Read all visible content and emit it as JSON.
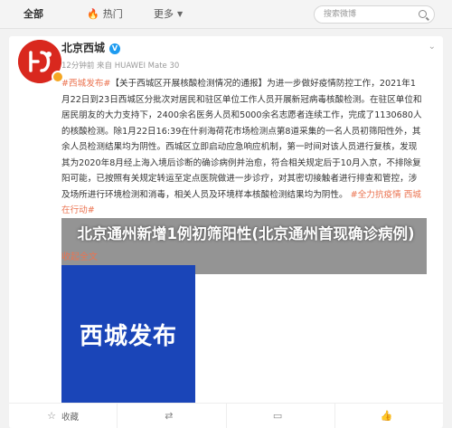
{
  "topbar": {
    "tabs": [
      {
        "label": "全部"
      },
      {
        "label": "热门"
      },
      {
        "label": "更多"
      }
    ],
    "search_placeholder": "搜索微博"
  },
  "post": {
    "author": "北京西城",
    "verified_mark": "V",
    "meta": "12分钟前 来自 HUAWEI Mate 30",
    "hashtag": "#西城发布#",
    "bracket_title": "【关于西城区开展核酸检测情况的通报】",
    "body_1": "为进一步做好疫情防控工作，2021年1月22日到23日西城区分批次对居民和驻区单位工作人员开展新冠病毒核酸检测。在驻区单位和居民朋友的大力支持下，2400余名医务人员和5000余名志愿者连续工作，完成了1130680人的核酸检测。除1月22日16:39在什刹海荷花市场检测点第8道采集的一名人员初筛阳性外，其余人员检测结果均为阴性。西城区立即启动应急响应机制，第一时间对该人员进行复核，发现其为2020年8月经上海入境后诊断的确诊病例并治愈，符合相关规定后于10月入京，不排除复阳可能，已按照有关规定转运至定点医院做进一步诊疗，对其密切接触者进行排查和管控，涉及场所进行环境检测和消毒，相关人员及环境样本核酸检测结果均为阴性。",
    "hashtag_2": "#全力抗疫情 西城在行动#",
    "collapse": "收起全文",
    "image_text": "西城发布",
    "overlay_title": "北京通州新增1例初筛阳性(北京通州首现确诊病例)"
  },
  "actions": [
    {
      "label": "收藏"
    },
    {
      "label": ""
    },
    {
      "label": ""
    },
    {
      "label": ""
    }
  ]
}
